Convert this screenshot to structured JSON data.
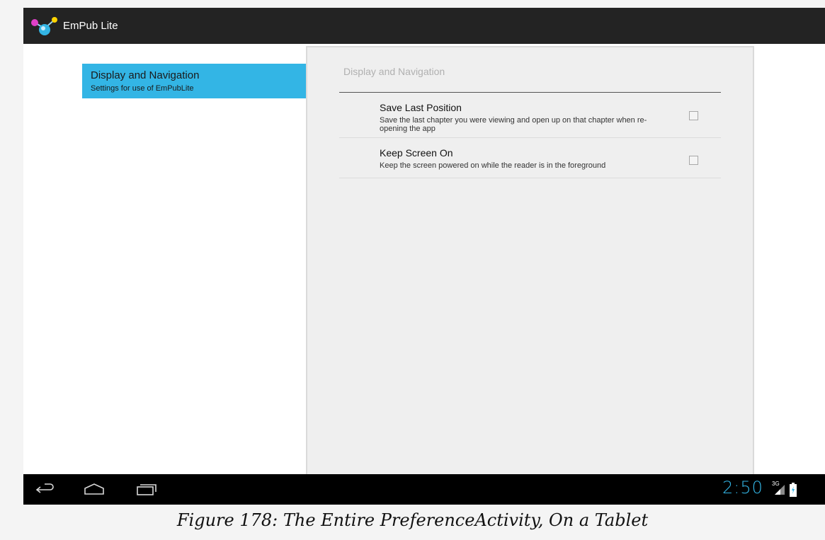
{
  "app": {
    "title": "EmPub Lite",
    "logo_icon": "molecule-logo-icon"
  },
  "headers": {
    "items": [
      {
        "title": "Display and Navigation",
        "summary": "Settings for use of EmPubLite",
        "selected": true
      }
    ]
  },
  "preferences": {
    "category_title": "Display and Navigation",
    "items": [
      {
        "title": "Save Last Position",
        "summary": "Save the last chapter you were viewing and open up on that chapter when re-opening the app",
        "checked": false
      },
      {
        "title": "Keep Screen On",
        "summary": "Keep the screen powered on while the reader is in the foreground",
        "checked": false
      }
    ]
  },
  "system_bar": {
    "back_icon": "back-arrow-icon",
    "home_icon": "home-icon",
    "recents_icon": "recent-apps-icon",
    "clock": "2:50",
    "network_label": "3G",
    "signal_icon": "signal-icon",
    "battery_icon": "battery-charging-icon"
  },
  "caption": "Figure 178: The Entire PreferenceActivity, On a Tablet",
  "colors": {
    "accent": "#33b5e5",
    "action_bar": "#232323",
    "nav_bar": "#000000",
    "panel": "#efefef"
  }
}
